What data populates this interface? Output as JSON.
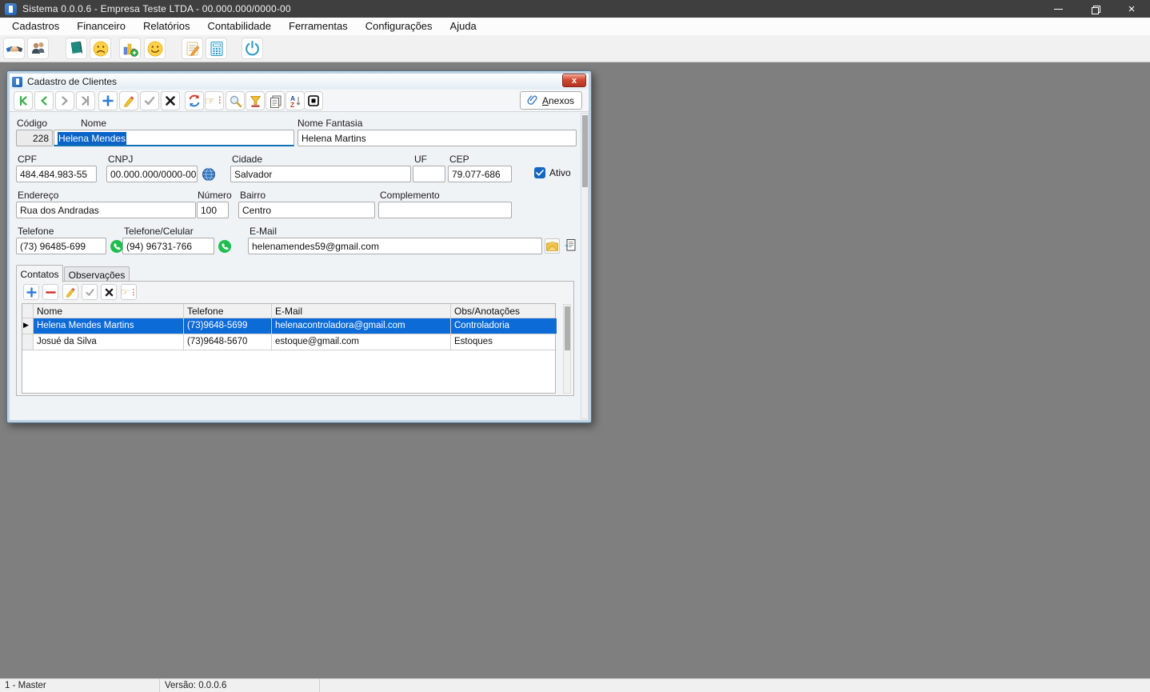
{
  "window": {
    "title": "Sistema 0.0.0.6 - Empresa Teste LTDA - 00.000.000/0000-00",
    "menu": [
      "Cadastros",
      "Financeiro",
      "Relatórios",
      "Contabilidade",
      "Ferramentas",
      "Configurações",
      "Ajuda"
    ],
    "toolbar_icons": [
      "handshake-icon",
      "clients-icon",
      "book-icon",
      "sad-face-icon",
      "chart-add-icon",
      "happy-face-icon",
      "note-edit-icon",
      "calculator-icon",
      "power-icon"
    ]
  },
  "dialog": {
    "title": "Cadastro de Clientes",
    "close_label": "x",
    "attachments": {
      "initial": "A",
      "rest": "nexos"
    },
    "toolbar_icons": [
      "nav-first-icon",
      "nav-prev-icon",
      "nav-next-icon",
      "nav-last-icon",
      "add-icon",
      "edit-icon",
      "confirm-icon",
      "cancel-icon",
      "refresh-icon",
      "locate-icon",
      "search-icon",
      "filter-icon",
      "report-icon",
      "sort-az-icon",
      "stop-icon"
    ],
    "form": {
      "codigo_label": "Código",
      "codigo_value": "228",
      "nome_label": "Nome",
      "nome_value": "Helena Mendes",
      "nome_fantasia_label": "Nome Fantasia",
      "nome_fantasia_value": "Helena Martins",
      "cpf_label": "CPF",
      "cpf_value": "484.484.983-55",
      "cnpj_label": "CNPJ",
      "cnpj_value": "00.000.000/0000-00",
      "cidade_label": "Cidade",
      "cidade_value": "Salvador",
      "uf_label": "UF",
      "uf_value": "",
      "cep_label": "CEP",
      "cep_value": "79.077-686",
      "ativo_label": "Ativo",
      "endereco_label": "Endereço",
      "endereco_value": "Rua dos Andradas",
      "numero_label": "Número",
      "numero_value": "100",
      "bairro_label": "Bairro",
      "bairro_value": "Centro",
      "complemento_label": "Complemento",
      "complemento_value": "",
      "telefone_label": "Telefone",
      "telefone_value": "(73) 96485-699",
      "celular_label": "Telefone/Celular",
      "celular_value": "(94) 96731-766",
      "email_label": "E-Mail",
      "email_value": "helenamendes59@gmail.com"
    },
    "tabs": {
      "contatos": "Contatos",
      "observacoes": "Observações"
    },
    "grid": {
      "headers": [
        "Nome",
        "Telefone",
        "E-Mail",
        "Obs/Anotações"
      ],
      "selected_indicator": "▶",
      "rows": [
        {
          "nome": "Helena Mendes Martins",
          "telefone": "(73)9648-5699",
          "email": "helenacontroladora@gmail.com",
          "obs": "Controladoria"
        },
        {
          "nome": "Josué da Silva",
          "telefone": "(73)9648-5670",
          "email": "estoque@gmail.com",
          "obs": "Estoques"
        }
      ]
    }
  },
  "statusbar": {
    "user": "1 - Master",
    "version": "Versão: 0.0.0.6"
  },
  "colors": {
    "selection_blue": "#0a64c8",
    "grid_selection": "#0d6bd7",
    "mdi_background": "#7f7f7f",
    "whatsapp_green": "#1ebe4f",
    "checkbox_blue": "#1466c0",
    "dialog_frame": "#bed4e4"
  }
}
